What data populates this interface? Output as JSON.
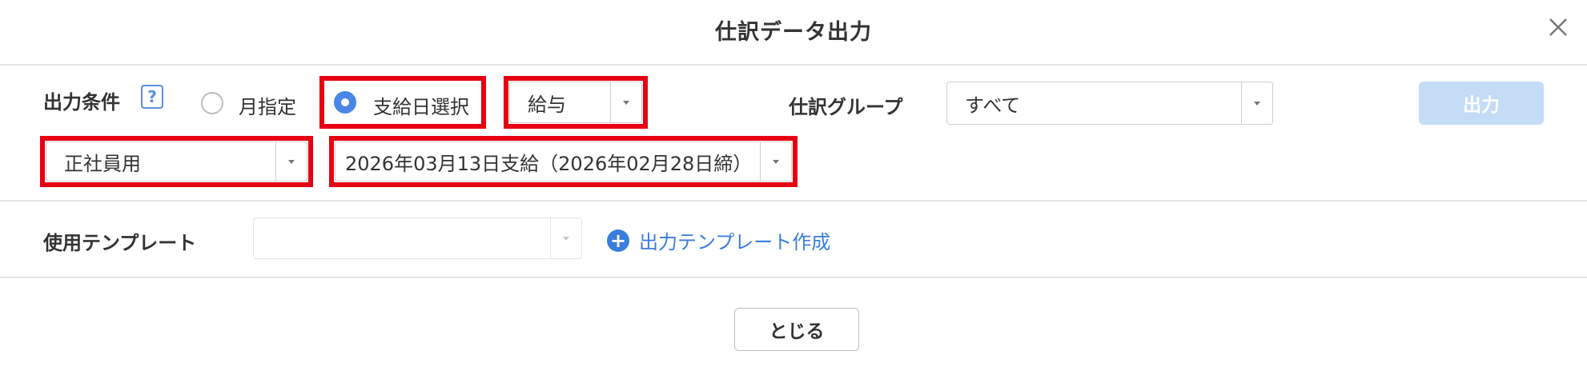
{
  "dialog": {
    "title": "仕訳データ出力",
    "close_icon": "close-icon"
  },
  "conditions": {
    "label": "出力条件",
    "help_label": "?",
    "radio_month": {
      "label": "月指定",
      "checked": false
    },
    "radio_payday": {
      "label": "支給日選択",
      "checked": true
    },
    "pay_type": {
      "value": "給与"
    },
    "journal_group": {
      "label": "仕訳グループ",
      "value": "すべて"
    },
    "output_button": "出力",
    "employee_group": {
      "value": "正社員用"
    },
    "pay_date": {
      "value": "2026年03月13日支給（2026年02月28日締）"
    }
  },
  "template": {
    "label": "使用テンプレート",
    "value": "",
    "create_link": "出力テンプレート作成",
    "create_icon": "plus-circle-icon"
  },
  "footer": {
    "close_button": "とじる"
  },
  "colors": {
    "highlight": "#e60012",
    "accent": "#4a86e8",
    "link": "#3b7ddd",
    "disabled_button": "#c5dcf7"
  }
}
